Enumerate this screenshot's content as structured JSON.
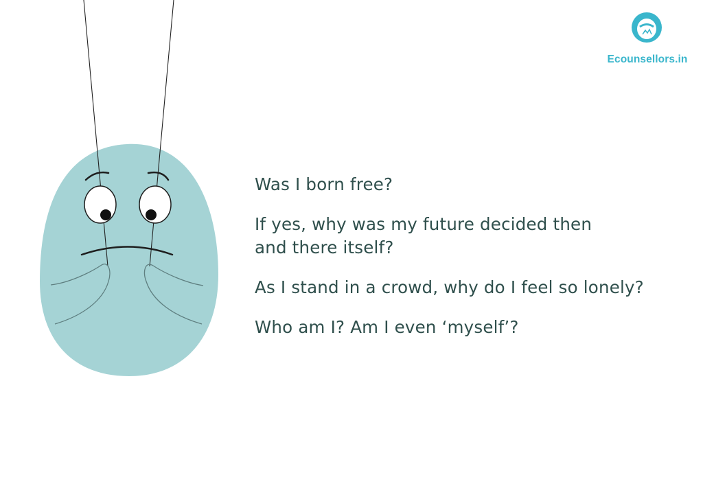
{
  "brand": {
    "name": "Ecounsellors.in",
    "icon": "ecounsellors-logo-icon",
    "color": "#3ab6cc"
  },
  "illustration": {
    "subject": "sad-blob-puppet",
    "body_color": "#a5d3d5"
  },
  "questions": [
    {
      "lines": [
        "Was I born free?"
      ]
    },
    {
      "lines": [
        "If yes, why was my future decided then",
        "and there itself?"
      ]
    },
    {
      "lines": [
        "As I stand in a crowd, why do I feel so lonely?"
      ]
    },
    {
      "lines": [
        "Who am I? Am I even ‘myself’?"
      ]
    }
  ],
  "text_color": "#2f4f4c"
}
